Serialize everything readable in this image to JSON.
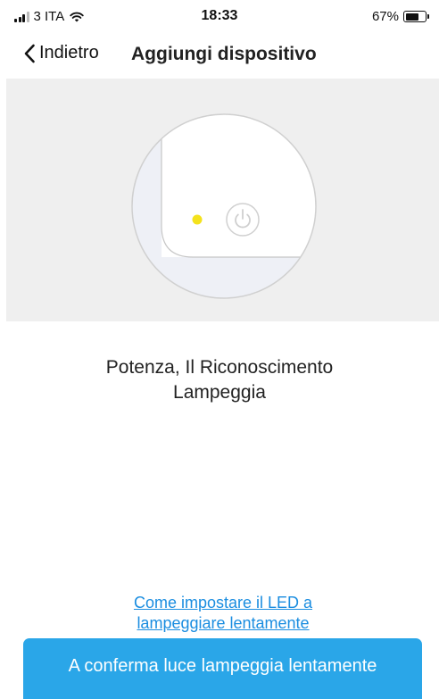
{
  "status_bar": {
    "carrier": "3 ITA",
    "time": "18:33",
    "battery": "67%",
    "battery_level": 0.67,
    "signal_icon": "signal-bars-icon",
    "wifi_icon": "wifi-icon",
    "battery_icon": "battery-icon"
  },
  "nav": {
    "back_label": "Indietro",
    "back_icon": "chevron-left-icon",
    "title": "Aggiungi dispositivo"
  },
  "illustration": {
    "led_color": "#f4e21c",
    "power_icon": "power-icon",
    "background": "#efefef"
  },
  "instruction": {
    "line1": "Potenza, Il Riconoscimento",
    "line2": "Lampeggia"
  },
  "help_link": {
    "line1": "Come impostare il LED a",
    "line2": "lampeggiare lentamente"
  },
  "confirm_button": {
    "label": "A conferma luce lampeggia lentamente",
    "color": "#2aa6e8"
  }
}
